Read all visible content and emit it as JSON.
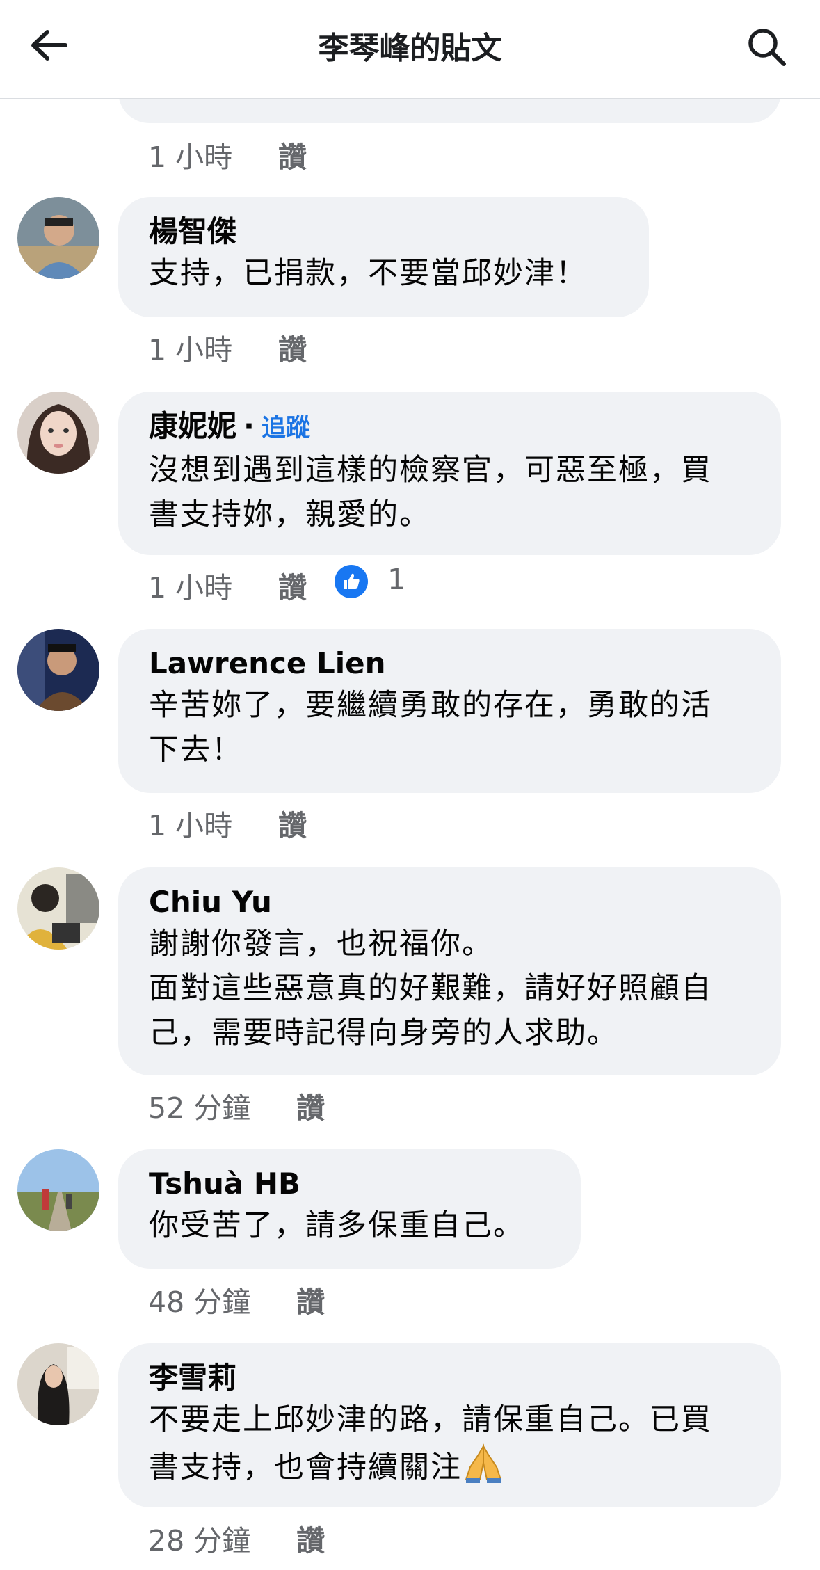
{
  "header": {
    "title": "李琴峰的貼文",
    "back_icon": "arrow-left-icon",
    "search_icon": "search-icon"
  },
  "colors": {
    "bubble": "#f0f2f5",
    "meta_text": "#65676b",
    "link_blue": "#1b74e4",
    "like_blue": "#1877f2"
  },
  "top": {
    "time": "1 小時",
    "like": "讚"
  },
  "comments": [
    {
      "name": "楊智傑",
      "text": "支持，已捐款，不要當邱妙津！",
      "time": "1 小時",
      "like": "讚"
    },
    {
      "name": "康妮妮",
      "separator": "·",
      "follow": "追蹤",
      "text": "沒想到遇到這樣的檢察官，可惡至極，買\n書支持妳，親愛的。",
      "time": "1 小時",
      "like": "讚",
      "reaction_icon": "thumbs-up-icon",
      "reaction_count": "1"
    },
    {
      "name": "Lawrence Lien",
      "text": "辛苦妳了，要繼續勇敢的存在，勇敢的活\n下去！",
      "time": "1 小時",
      "like": "讚"
    },
    {
      "name": "Chiu Yu",
      "text": "謝謝你發言，也祝福你。\n面對這些惡意真的好艱難，請好好照顧自\n己，需要時記得向身旁的人求助。",
      "time": "52 分鐘",
      "like": "讚"
    },
    {
      "name": "Tshuà HB",
      "text": "你受苦了，請多保重自己。",
      "time": "48 分鐘",
      "like": "讚"
    },
    {
      "name": "李雪莉",
      "text": "不要走上邱妙津的路，請保重自己。已買\n書支持，也會持續關注",
      "emoji_icon": "folded-hands-icon",
      "time": "28 分鐘",
      "like": "讚"
    }
  ]
}
